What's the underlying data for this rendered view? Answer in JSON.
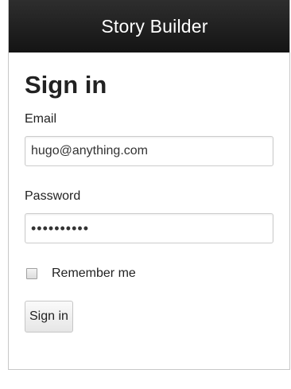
{
  "navbar": {
    "brand": "Story Builder"
  },
  "form": {
    "title": "Sign in",
    "email_label": "Email",
    "email_value": "hugo@anything.com",
    "password_label": "Password",
    "password_value": "••••••••••",
    "remember_label": "Remember me",
    "remember_checked": false,
    "submit_label": "Sign in"
  }
}
